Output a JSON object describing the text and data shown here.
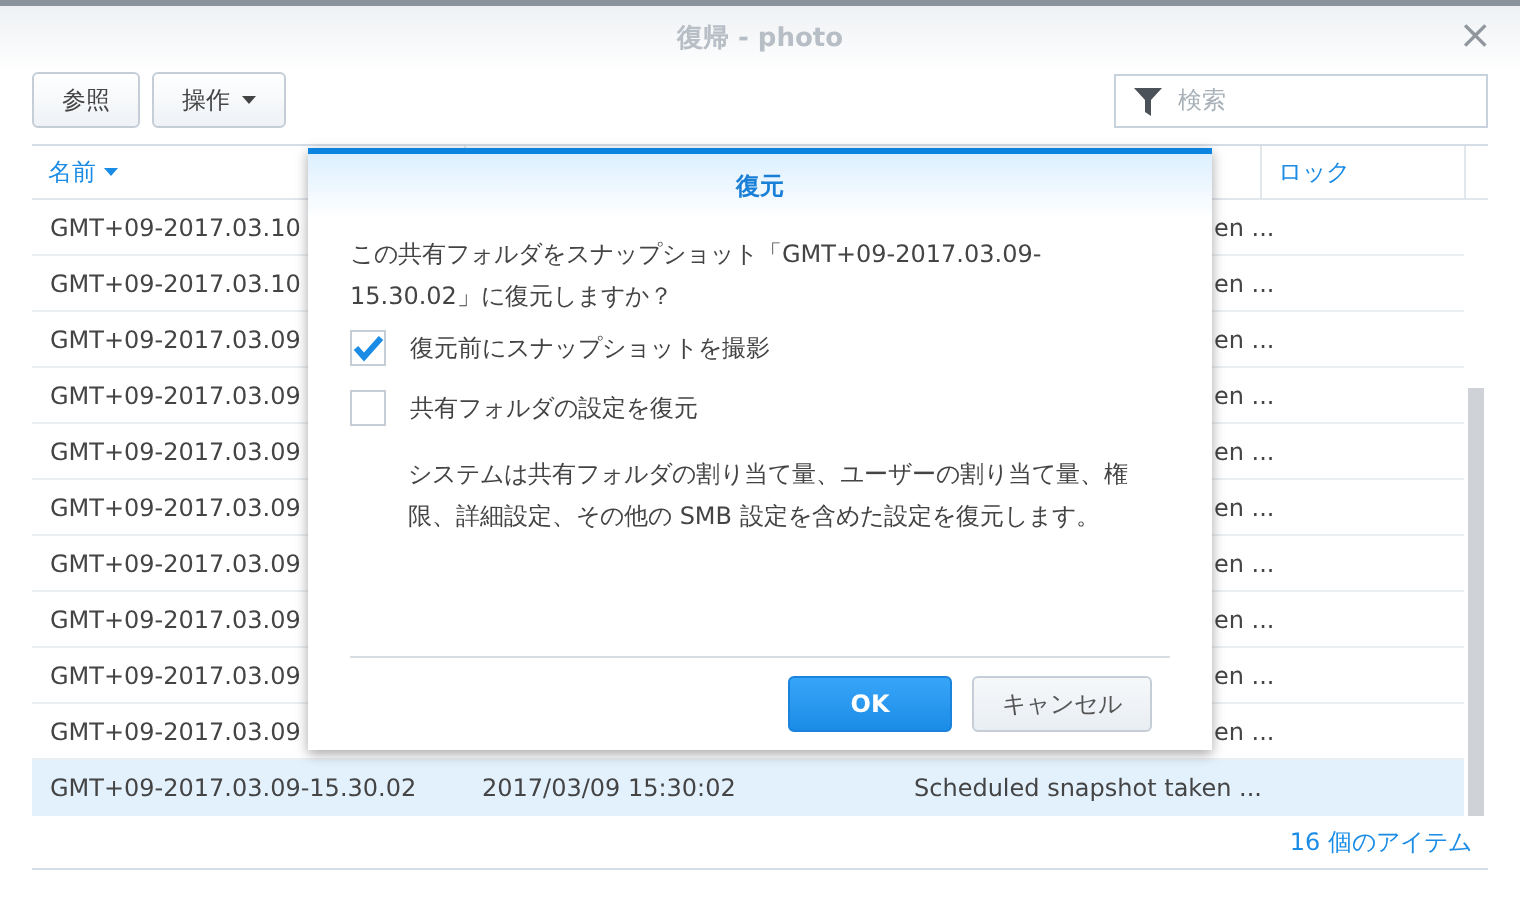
{
  "window": {
    "title": "復帰 - photo",
    "close": "×"
  },
  "toolbar": {
    "buttons": [
      {
        "label": "参照",
        "dropdown": false
      },
      {
        "label": "操作",
        "dropdown": true
      }
    ],
    "search": {
      "placeholder": "検索"
    }
  },
  "table": {
    "columns": [
      {
        "label": "名前",
        "sorted": true
      },
      {
        "label": "ロック",
        "sorted": false
      }
    ],
    "rows": [
      {
        "name": "GMT+09-2017.03.10",
        "description": "en ...",
        "selected": false
      },
      {
        "name": "GMT+09-2017.03.10",
        "description": "en ...",
        "selected": false
      },
      {
        "name": "GMT+09-2017.03.09",
        "description": "en ...",
        "selected": false
      },
      {
        "name": "GMT+09-2017.03.09",
        "description": "en ...",
        "selected": false
      },
      {
        "name": "GMT+09-2017.03.09",
        "description": "en ...",
        "selected": false
      },
      {
        "name": "GMT+09-2017.03.09",
        "description": "en ...",
        "selected": false
      },
      {
        "name": "GMT+09-2017.03.09",
        "description": "en ...",
        "selected": false
      },
      {
        "name": "GMT+09-2017.03.09",
        "description": "en ...",
        "selected": false
      },
      {
        "name": "GMT+09-2017.03.09",
        "description": "en ...",
        "selected": false
      },
      {
        "name": "GMT+09-2017.03.09",
        "description": "en ...",
        "selected": false
      },
      {
        "name": "GMT+09-2017.03.09-15.30.02",
        "date": "2017/03/09 15:30:02",
        "description": "Scheduled snapshot taken ...",
        "selected": true
      }
    ],
    "item_count": "16 個のアイテム"
  },
  "dialog": {
    "title": "復元",
    "message": "この共有フォルダをスナップショット「GMT+09-2017.03.09-15.30.02」に復元しますか？",
    "options": [
      {
        "label": "復元前にスナップショットを撮影",
        "checked": true
      },
      {
        "label": "共有フォルダの設定を復元",
        "checked": false
      }
    ],
    "note": "システムは共有フォルダの割り当て量、ユーザーの割り当て量、権限、詳細設定、その他の SMB 設定を含めた設定を復元します。",
    "buttons": [
      {
        "label": "OK",
        "primary": true
      },
      {
        "label": "キャンセル",
        "primary": false
      }
    ]
  }
}
